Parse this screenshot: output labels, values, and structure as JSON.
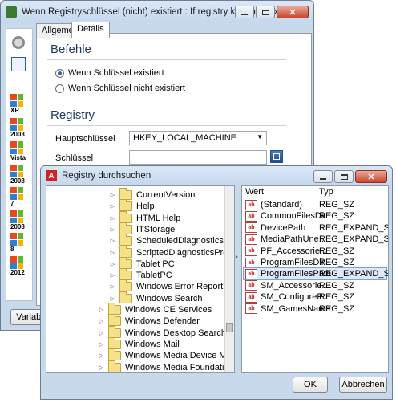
{
  "main_window": {
    "title": "Wenn Registryschlüssel (nicht) existiert : If registry key (not) exists",
    "tabs": [
      "Allgemein",
      "Details"
    ],
    "befehle_title": "Befehle",
    "radio_exists": "Wenn Schlüssel existiert",
    "radio_not_exists": "Wenn Schlüssel nicht existiert",
    "registry_title": "Registry",
    "hauptschluessel_label": "Hauptschlüssel",
    "hauptschluessel_value": "HKEY_LOCAL_MACHINE",
    "schluessel_label": "Schlüssel",
    "schluessel_value": "",
    "variable_button": "Variable",
    "os_labels": [
      "XP",
      "2003",
      "Vista",
      "2008",
      "7",
      "2008",
      "8",
      "2012"
    ]
  },
  "dialog": {
    "title": "Registry durchsuchen",
    "tree": [
      {
        "label": "CurrentVersion",
        "level": 2
      },
      {
        "label": "Help",
        "level": 2
      },
      {
        "label": "HTML Help",
        "level": 2
      },
      {
        "label": "ITStorage",
        "level": 2
      },
      {
        "label": "ScheduledDiagnostics",
        "level": 2
      },
      {
        "label": "ScriptedDiagnosticsProvider",
        "level": 2
      },
      {
        "label": "Tablet PC",
        "level": 2
      },
      {
        "label": "TabletPC",
        "level": 2
      },
      {
        "label": "Windows Error Reporting",
        "level": 2
      },
      {
        "label": "Windows Search",
        "level": 2
      },
      {
        "label": "Windows CE Services",
        "level": 1
      },
      {
        "label": "Windows Defender",
        "level": 1
      },
      {
        "label": "Windows Desktop Search",
        "level": 1
      },
      {
        "label": "Windows Mail",
        "level": 1
      },
      {
        "label": "Windows Media Device Manager",
        "level": 1
      },
      {
        "label": "Windows Media Foundation",
        "level": 1
      }
    ],
    "col_wert": "Wert",
    "col_typ": "Typ",
    "values": [
      {
        "name": "(Standard)",
        "type": "REG_SZ"
      },
      {
        "name": "CommonFilesDir",
        "type": "REG_SZ"
      },
      {
        "name": "DevicePath",
        "type": "REG_EXPAND_SZ"
      },
      {
        "name": "MediaPathUne...",
        "type": "REG_EXPAND_SZ"
      },
      {
        "name": "PF_Accessorie...",
        "type": "REG_SZ"
      },
      {
        "name": "ProgramFilesDir",
        "type": "REG_SZ"
      },
      {
        "name": "ProgramFilesPath",
        "type": "REG_EXPAND_SZ"
      },
      {
        "name": "SM_Accessorie...",
        "type": "REG_SZ"
      },
      {
        "name": "SM_ConfigureP...",
        "type": "REG_SZ"
      },
      {
        "name": "SM_GamesName",
        "type": "REG_SZ"
      }
    ],
    "selected_value_index": 6,
    "ok_button": "OK",
    "cancel_button": "Abbrechen"
  }
}
